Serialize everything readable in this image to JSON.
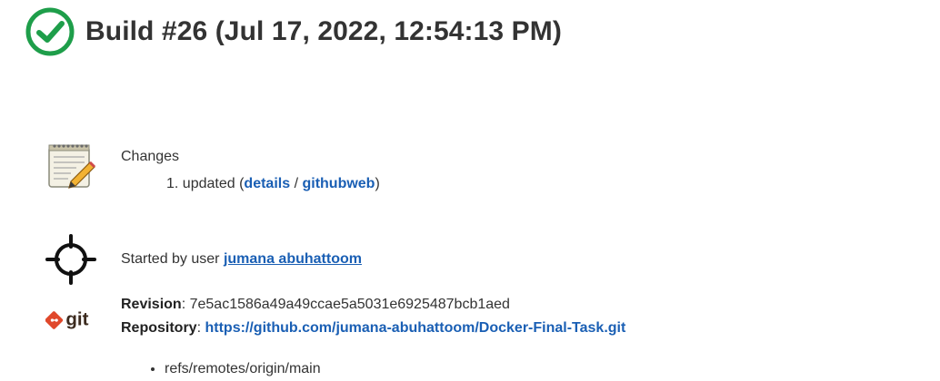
{
  "header": {
    "title": "Build #26 (Jul 17, 2022, 12:54:13 PM)",
    "status_icon": "success-check-icon",
    "status_color": "#1e9e4a"
  },
  "changes": {
    "label": "Changes",
    "icon": "notepad-pencil-icon",
    "items": [
      {
        "number": "1.",
        "text": "updated",
        "open_paren": "(",
        "details_label": "details",
        "separator": "/",
        "githubweb_label": "githubweb",
        "close_paren": ")"
      }
    ]
  },
  "started": {
    "icon": "crosshair-icon",
    "prefix": "Started by user",
    "user": "jumana abuhattoom"
  },
  "git": {
    "icon": "git-logo-icon",
    "logo_text": "git",
    "revision_label": "Revision",
    "revision_value": "7e5ac1586a49a49ccae5a5031e6925487bcb1aed",
    "repository_label": "Repository",
    "repository_url": "https://github.com/jumana-abuhattoom/Docker-Final-Task.git",
    "colon": ":",
    "branches": [
      "refs/remotes/origin/main"
    ]
  },
  "colors": {
    "link": "#1a5fb4",
    "text": "#333333",
    "git_orange": "#e0482b"
  }
}
